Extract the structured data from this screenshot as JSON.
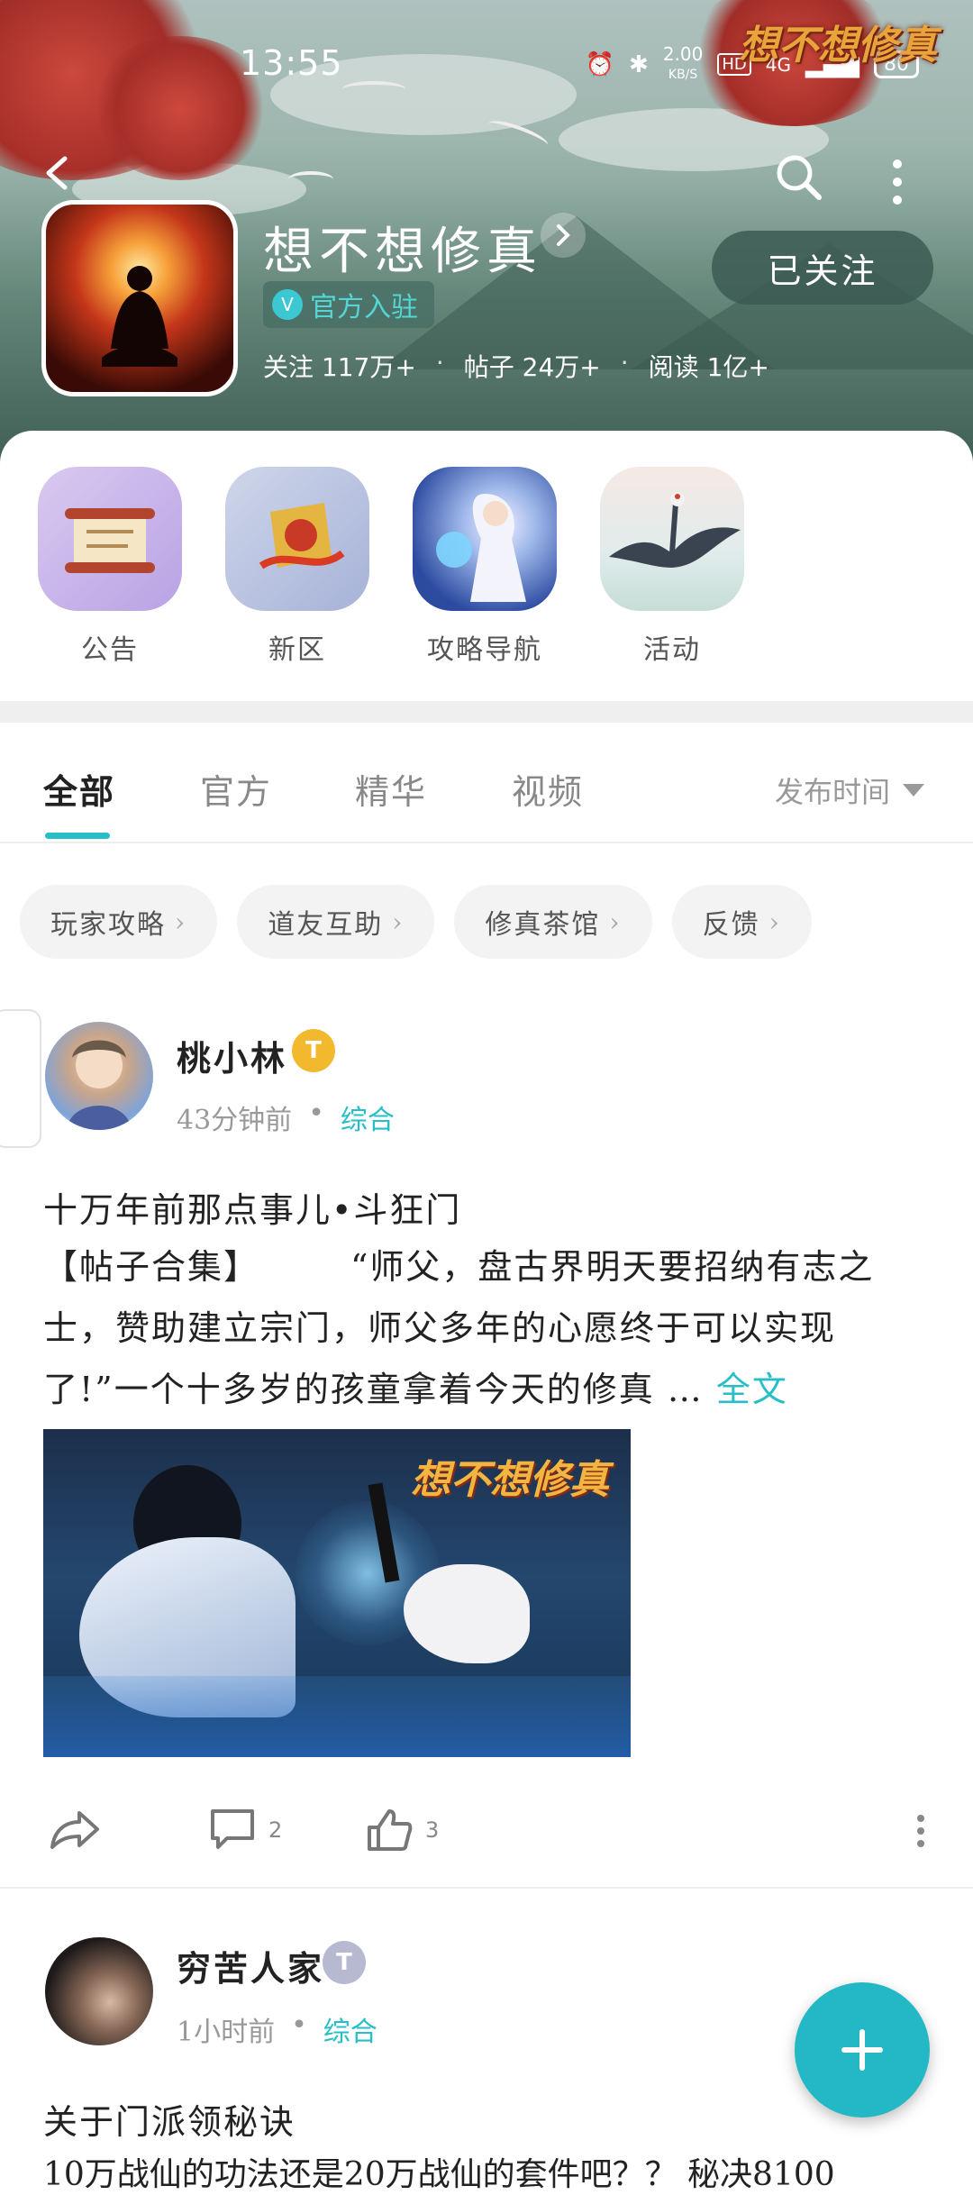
{
  "status_bar": {
    "time": "13:55",
    "net_speed": "2.00",
    "net_unit": "KB/S",
    "hd": "HD",
    "signal": "4G",
    "battery": "80"
  },
  "header": {
    "corner_logo": "想不想修真",
    "game_name": "想不想修真",
    "official_badge": "官方入驻",
    "stats": [
      {
        "label": "关注",
        "value": "117万+"
      },
      {
        "label": "帖子",
        "value": "24万+"
      },
      {
        "label": "阅读",
        "value": "1亿+"
      }
    ],
    "stat_separator": "·",
    "follow_button": "已关注"
  },
  "quick_access": [
    {
      "label": "公告",
      "icon": "scroll-icon"
    },
    {
      "label": "新区",
      "icon": "gift-icon"
    },
    {
      "label": "攻略导航",
      "icon": "fairy-icon"
    },
    {
      "label": "活动",
      "icon": "crane-icon"
    }
  ],
  "tabs": {
    "items": [
      "全部",
      "官方",
      "精华",
      "视频"
    ],
    "active_index": 0,
    "sort_label": "发布时间"
  },
  "chips": [
    "玩家攻略",
    "道友互助",
    "修真茶馆",
    "反馈"
  ],
  "post1": {
    "author": "桃小林",
    "level": "T",
    "time": "43分钟前",
    "category": "综合",
    "title": "十万年前那点事儿•斗狂门",
    "body": "【帖子合集】　　　“师父，盘古界明天要招纳有志之士，赞助建立宗门，师父多年的心愿终于可以实现了!”一个十多岁的孩童拿着今天的修真 …",
    "more": "全文",
    "image_logo": "想不想修真",
    "comments": "2",
    "likes": "3"
  },
  "post2": {
    "author": "穷苦人家",
    "level": "T",
    "time": "1小时前",
    "category": "综合",
    "title": "关于门派领秘诀",
    "line": "10万战仙的功法还是20万战仙的套件吧？？ 秘决8100"
  },
  "colors": {
    "accent": "#28bec8",
    "fab": "#24b8c6",
    "gold_level": "#f3b92e"
  }
}
